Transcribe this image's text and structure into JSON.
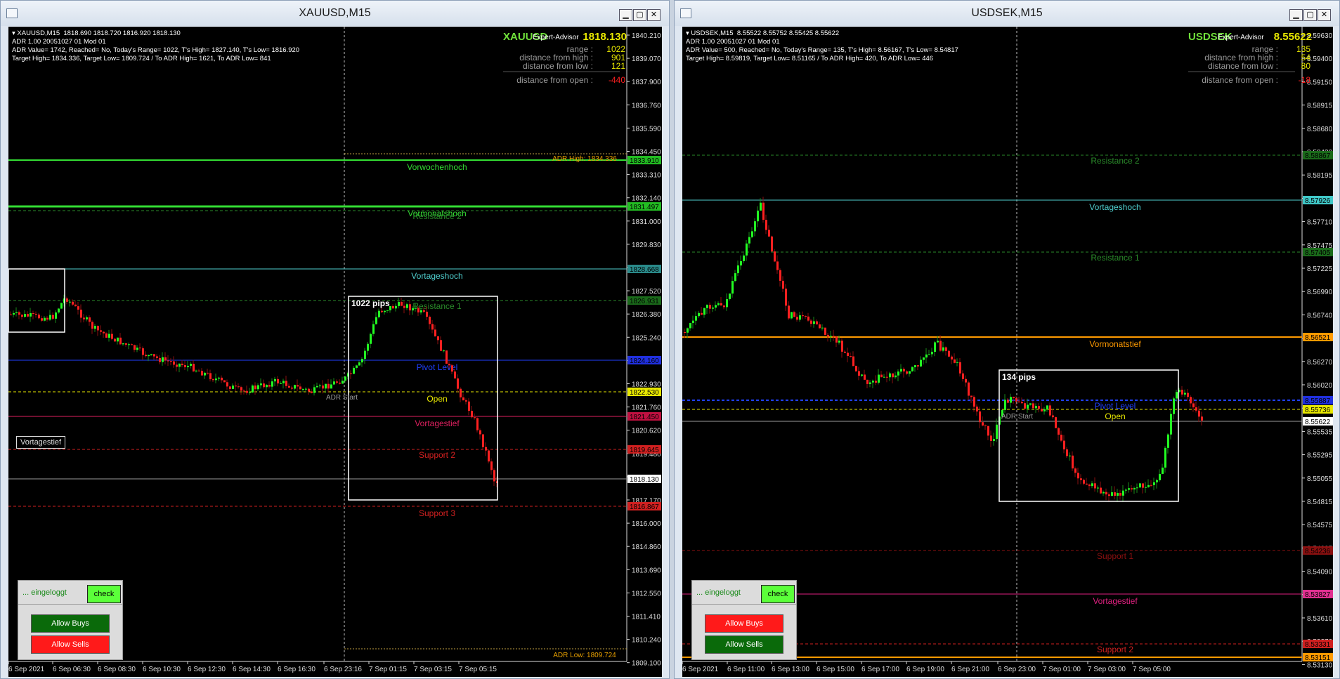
{
  "windows": [
    {
      "id": "xau",
      "title": "XAUUSD,M15",
      "info_lines": [
        "▾ XAUUSD,M15  1818.690 1818.720 1816.920 1818.130",
        "ADR 1.00 20051027 01 Mod 01",
        "ADR Value= 1742, Reached= No, Today's Range= 1022, T's High= 1827.140, T's Low= 1816.920",
        "Target High= 1834.336, Target Low= 1809.724 / To ADR High= 1621, To ADR Low= 841"
      ],
      "panel": {
        "symbol": "XAUUSD",
        "ea": "Expert-Advisor",
        "bid": "1818.130",
        "rows": [
          {
            "label": "range :",
            "value": "1022",
            "color": "#e8e800"
          },
          {
            "label": "distance from high :",
            "value": "901",
            "color": "#e8e800"
          },
          {
            "label": "distance from low :",
            "value": "121",
            "color": "#e8e800"
          },
          {
            "label": "distance from open :",
            "value": "-440",
            "color": "#ff2020"
          }
        ]
      },
      "price_axis": [
        "1840.210",
        "1839.070",
        "1837.900",
        "1836.760",
        "1835.590",
        "1834.450",
        "1833.310",
        "1832.140",
        "1831.000",
        "1829.830",
        "1828.690",
        "1827.520",
        "1826.380",
        "1825.240",
        "1824.070",
        "1822.930",
        "1821.760",
        "1820.620",
        "1819.480",
        "1818.310",
        "1817.170",
        "1816.000",
        "1814.860",
        "1813.690",
        "1812.550",
        "1811.410",
        "1810.240",
        "1809.100"
      ],
      "time_axis": [
        "6 Sep 2021",
        "6 Sep 06:30",
        "6 Sep 08:30",
        "6 Sep 10:30",
        "6 Sep 12:30",
        "6 Sep 14:30",
        "6 Sep 16:30",
        "6 Sep 23:16",
        "7 Sep 01:15",
        "7 Sep 03:15",
        "7 Sep 05:15"
      ],
      "levels": [
        {
          "label": "Vorwochenhoch",
          "color": "#33dd33",
          "tag": "1833.910",
          "tagcolor": "#22bb22"
        },
        {
          "label": "Vormonatshoch",
          "color": "#33dd33",
          "tag": "1831.497",
          "tagcolor": "#22bb22"
        },
        {
          "label": "Resistance 2",
          "color": "#2a8a2a",
          "tag": "",
          "tagcolor": "#1a6a1a"
        },
        {
          "label": "Vortageshoch",
          "color": "#50d0d0",
          "tag": "1828.668",
          "tagcolor": "#2a8a8a"
        },
        {
          "label": "Resistance 1",
          "color": "#2a8a2a",
          "tag": "1826.931",
          "tagcolor": "#1a6a1a"
        },
        {
          "label": "Pivot Level",
          "color": "#2040ff",
          "tag": "1824.160",
          "tagcolor": "#2030e0"
        },
        {
          "label": "Open",
          "color": "#e8e800",
          "tag": "1822.530",
          "tagcolor": "#e8e800"
        },
        {
          "label": "Vortagestief",
          "color": "#e02060",
          "tag": "1821.450",
          "tagcolor": "#c01040"
        },
        {
          "label": "Support 2",
          "color": "#d02020",
          "tag": "1819.645",
          "tagcolor": "#d02020"
        },
        {
          "label": "",
          "color": "#9a9a9a",
          "tag": "1818.130",
          "tagcolor": "#ffffff"
        },
        {
          "label": "Support 3",
          "color": "#d02020",
          "tag": "1816.867",
          "tagcolor": "#d02020"
        }
      ],
      "adr_high": "ADR High: 1834.336",
      "adr_low": "ADR Low: 1809.724",
      "adr_start": "ADR Start",
      "pips_box": "1022 pips",
      "vortagestief_tag": "Vortagestief",
      "login_text": "... eingeloggt",
      "check_label": "check",
      "buttons": [
        {
          "label": "Allow Buys",
          "color": "#0a6a0a"
        },
        {
          "label": "Allow Sells",
          "color": "#ff1a1a"
        }
      ]
    },
    {
      "id": "sek",
      "title": "USDSEK,M15",
      "info_lines": [
        "▾ USDSEK,M15  8.55522 8.55752 8.55425 8.55622",
        "ADR 1.00 20051027 01 Mod 01",
        "ADR Value= 500, Reached= No, Today's Range= 135, T's High= 8.56167, T's Low= 8.54817",
        "Target High= 8.59819, Target Low= 8.51165 / To ADR High= 420, To ADR Low= 446"
      ],
      "panel": {
        "symbol": "USDSEK",
        "ea": "Expert-Advisor",
        "bid": "8.55622",
        "rows": [
          {
            "label": "range :",
            "value": "135",
            "color": "#e8e800"
          },
          {
            "label": "distance from high :",
            "value": "54",
            "color": "#e8e800"
          },
          {
            "label": "distance from low :",
            "value": "80",
            "color": "#e8e800"
          },
          {
            "label": "distance from open :",
            "value": "-18",
            "color": "#ff2020"
          }
        ]
      },
      "price_axis": [
        "8.59630",
        "8.59400",
        "8.59150",
        "8.58915",
        "8.58680",
        "8.58430",
        "8.58195",
        "8.57960",
        "8.57710",
        "8.57475",
        "8.57225",
        "8.56990",
        "8.56740",
        "8.56505",
        "8.56270",
        "8.56020",
        "8.55785",
        "8.55535",
        "8.55295",
        "8.55055",
        "8.54815",
        "8.54575",
        "8.54325",
        "8.54090",
        "8.53840",
        "8.53610",
        "8.53370",
        "8.53130"
      ],
      "time_axis": [
        "6 Sep 2021",
        "6 Sep 11:00",
        "6 Sep 13:00",
        "6 Sep 15:00",
        "6 Sep 17:00",
        "6 Sep 19:00",
        "6 Sep 21:00",
        "6 Sep 23:00",
        "7 Sep 01:00",
        "7 Sep 03:00",
        "7 Sep 05:00"
      ],
      "levels": [
        {
          "label": "Resistance 2",
          "color": "#2a8a2a",
          "tag": "8.58867",
          "tagcolor": "#1a6a1a"
        },
        {
          "label": "Vortageshoch",
          "color": "#50d0d0",
          "tag": "8.57926",
          "tagcolor": "#40c8c8"
        },
        {
          "label": "Resistance 1",
          "color": "#2a8a2a",
          "tag": "8.57405",
          "tagcolor": "#1a6a1a"
        },
        {
          "label": "Vormonatstief",
          "color": "#ff9a00",
          "tag": "8.56521",
          "tagcolor": "#ff9a00"
        },
        {
          "label": "Pivot Level",
          "color": "#2040ff",
          "tag": "8.55887",
          "tagcolor": "#2030e0"
        },
        {
          "label": "Open",
          "color": "#e8e800",
          "tag": "8.55736",
          "tagcolor": "#e8e800"
        },
        {
          "label": "",
          "color": "#9a9a9a",
          "tag": "8.55622",
          "tagcolor": "#ffffff"
        },
        {
          "label": "Support 1",
          "color": "#8a1010",
          "tag": "8.54236",
          "tagcolor": "#8a1010"
        },
        {
          "label": "Vortagestief",
          "color": "#e02080",
          "tag": "8.53827",
          "tagcolor": "#e03090"
        },
        {
          "label": "Support 2",
          "color": "#d02020",
          "tag": "8.53331",
          "tagcolor": "#d02020"
        },
        {
          "label": "",
          "color": "#ff9a00",
          "tag": "8.53151",
          "tagcolor": "#ff9a00"
        }
      ],
      "adr_start": "ADR Start",
      "pips_box": "134 pips",
      "login_text": "... eingeloggt",
      "check_label": "check",
      "buttons": [
        {
          "label": "Allow Buys",
          "color": "#ff1a1a"
        },
        {
          "label": "Allow Sells",
          "color": "#0a6a0a"
        }
      ]
    }
  ]
}
